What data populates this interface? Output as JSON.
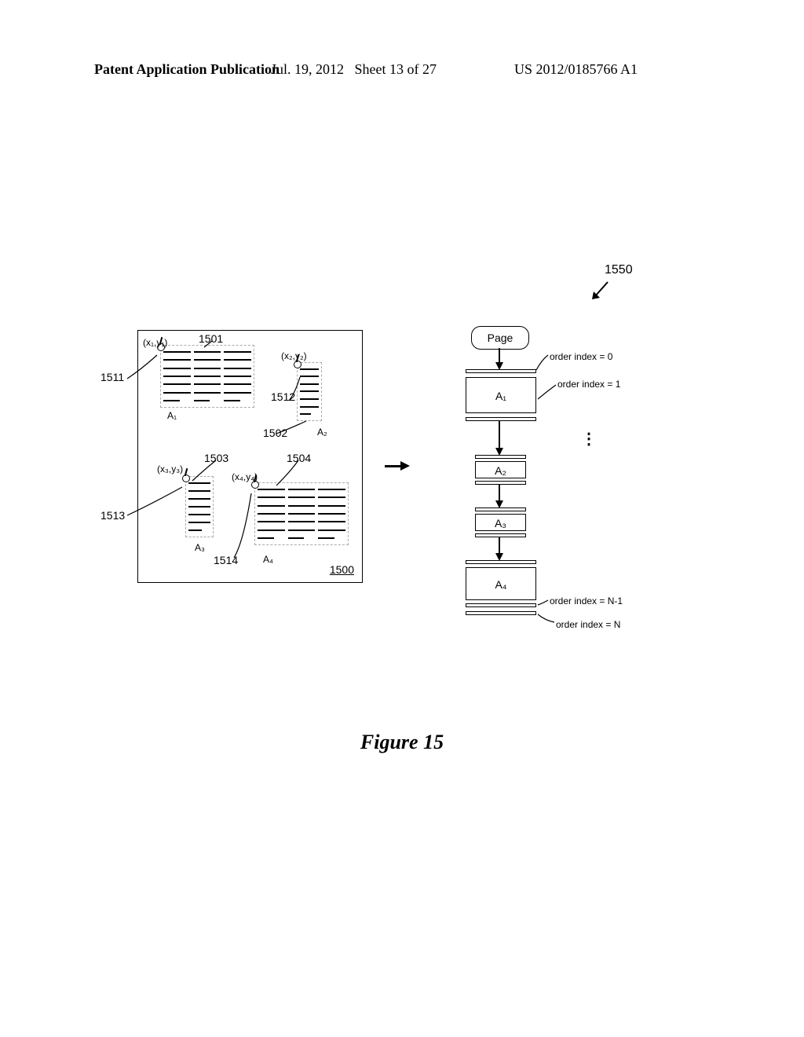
{
  "header": {
    "left": "Patent Application Publication",
    "date": "Jul. 19, 2012",
    "sheet": "Sheet 13 of 27",
    "docnum": "US 2012/0185766 A1"
  },
  "figure_caption": "Figure 15",
  "refs": {
    "r1550": "1550",
    "r1500": "1500",
    "r1501": "1501",
    "r1502": "1502",
    "r1503": "1503",
    "r1504": "1504",
    "r1511": "1511",
    "r1512": "1512",
    "r1513": "1513",
    "r1514": "1514"
  },
  "coords": {
    "c1": "(x₁,y₁)",
    "c2": "(x₂,y₂)",
    "c3": "(x₃,y₃)",
    "c4": "(x₄,y₄)"
  },
  "article_labels": {
    "a1": "A₁",
    "a2": "A₂",
    "a3": "A₃",
    "a4": "A₄"
  },
  "flow": {
    "page": "Page",
    "a1": "A₁",
    "a2": "A₂",
    "a3": "A₃",
    "a4": "A₄",
    "order0": "order index = 0",
    "order1": "order index = 1",
    "orderNm1": "order index = N-1",
    "orderN": "order index = N"
  }
}
